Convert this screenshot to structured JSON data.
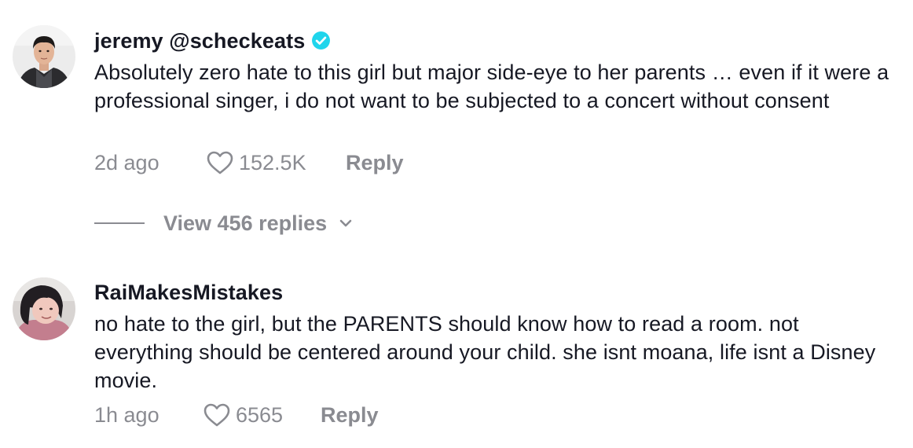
{
  "comments": [
    {
      "username": "jeremy @scheckeats",
      "verified": true,
      "text": "Absolutely zero hate to this girl but major side-eye to her parents … even if it were a professional singer, i do not want to be subjected to a concert without consent",
      "time": "2d ago",
      "likes": "152.5K",
      "reply_label": "Reply",
      "view_replies_label": "View 456 replies"
    },
    {
      "username": "RaiMakesMistakes",
      "verified": false,
      "text": "no hate to the girl, but the PARENTS should know how to read a room. not everything should be centered around your child. she isnt moana, life isnt a Disney movie.",
      "time": "1h ago",
      "likes": "6565",
      "reply_label": "Reply"
    }
  ],
  "colors": {
    "text": "#161823",
    "muted": "#8a8b91",
    "verified_badge": "#20d5ec"
  },
  "icons": {
    "like": "heart-outline-icon",
    "verified": "verified-check-icon",
    "expand": "chevron-down-icon"
  }
}
